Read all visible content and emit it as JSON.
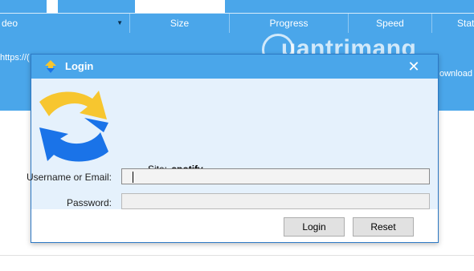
{
  "background": {
    "columns": [
      "deo",
      "Size",
      "Progress",
      "Speed",
      "Stat"
    ],
    "row_url_fragment": "https://(",
    "row_status_fragment": "ownload"
  },
  "watermark": {
    "text": "uantrimang"
  },
  "dialog": {
    "title": "Login",
    "close_glyph": "✕",
    "site_label": "Site:",
    "site_value": "spotify",
    "username_label": "Username or Email:",
    "username_value": "",
    "password_label": "Password:",
    "password_value": "",
    "login_button": "Login",
    "reset_button": "Reset"
  },
  "colors": {
    "accent": "#4aa6ea",
    "banner": "#e5f1fc",
    "logo_yellow": "#f7c62f",
    "logo_blue": "#1a73e8"
  }
}
